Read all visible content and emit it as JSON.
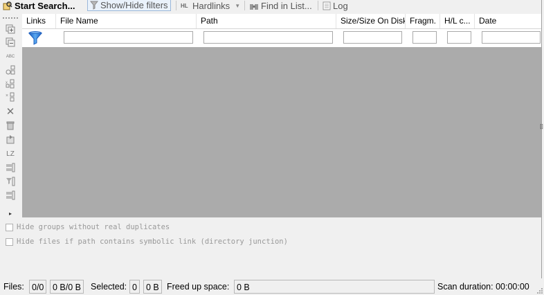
{
  "toolbar": {
    "start_search": "Start Search...",
    "show_hide_filters": "Show/Hide filters",
    "hardlinks": "Hardlinks",
    "hardlinks_prefix": "HL",
    "find_in_list": "Find in List...",
    "log": "Log"
  },
  "sidebar": {
    "lz_label": "LZ",
    "abc_label": "ABC"
  },
  "columns": [
    "Links",
    "File Name",
    "Path",
    "Size/Size On Disk",
    "Fragm.",
    "H/L c...",
    "Date"
  ],
  "options": {
    "hide_groups": "Hide groups without real duplicates",
    "hide_symlink": "Hide files if path contains symbolic link (directory junction)"
  },
  "status": {
    "files_label": "Files:",
    "files_count": "0/0",
    "files_size": "0 B/0 B",
    "selected_label": "Selected:",
    "selected_count": "0",
    "selected_size": "0 B",
    "freed_label": "Freed up space:",
    "freed_value": "0 B",
    "scan_duration": "Scan duration: 00:00:00"
  }
}
